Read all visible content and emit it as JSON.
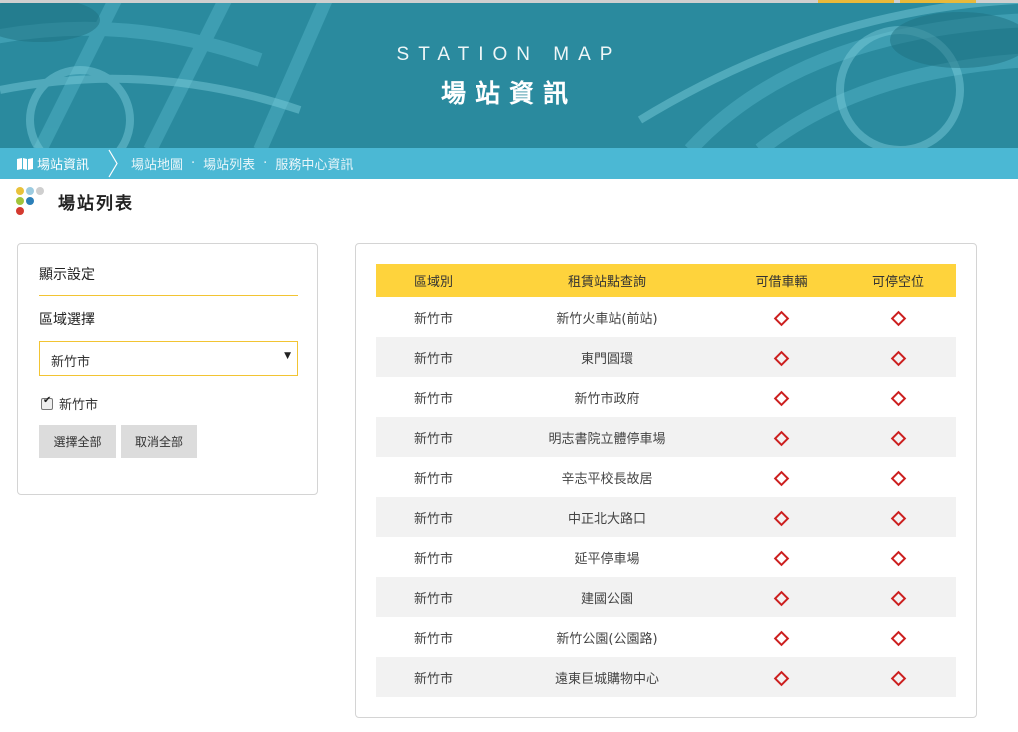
{
  "hero": {
    "title_en": "STATION MAP",
    "title_zh": "場站資訊"
  },
  "nav": {
    "current": "場站資訊",
    "links": [
      "場站地圖",
      "場站列表",
      "服務中心資訊"
    ],
    "separator": "·"
  },
  "page": {
    "title": "場站列表"
  },
  "settings": {
    "title": "顯示設定",
    "region_label": "區域選擇",
    "region_selected": "新竹市",
    "checkbox_label": "新竹市",
    "checkbox_checked": true,
    "select_all_label": "選擇全部",
    "deselect_all_label": "取消全部"
  },
  "table": {
    "headers": [
      "區域別",
      "租賃站點查詢",
      "可借車輛",
      "可停空位"
    ],
    "rows": [
      {
        "area": "新竹市",
        "name": "新竹火車站(前站)"
      },
      {
        "area": "新竹市",
        "name": "東門圓環"
      },
      {
        "area": "新竹市",
        "name": "新竹市政府"
      },
      {
        "area": "新竹市",
        "name": "明志書院立體停車場"
      },
      {
        "area": "新竹市",
        "name": "辛志平校長故居"
      },
      {
        "area": "新竹市",
        "name": "中正北大路口"
      },
      {
        "area": "新竹市",
        "name": "延平停車場"
      },
      {
        "area": "新竹市",
        "name": "建國公園"
      },
      {
        "area": "新竹市",
        "name": "新竹公園(公園路)"
      },
      {
        "area": "新竹市",
        "name": "遠東巨城購物中心"
      }
    ],
    "status_icon": "red-diamond-icon"
  },
  "colors": {
    "banner": "#2c8fa3",
    "navbar": "#4bb8d4",
    "accent_yellow": "#fed33c",
    "status_red": "#cc1f1f"
  }
}
